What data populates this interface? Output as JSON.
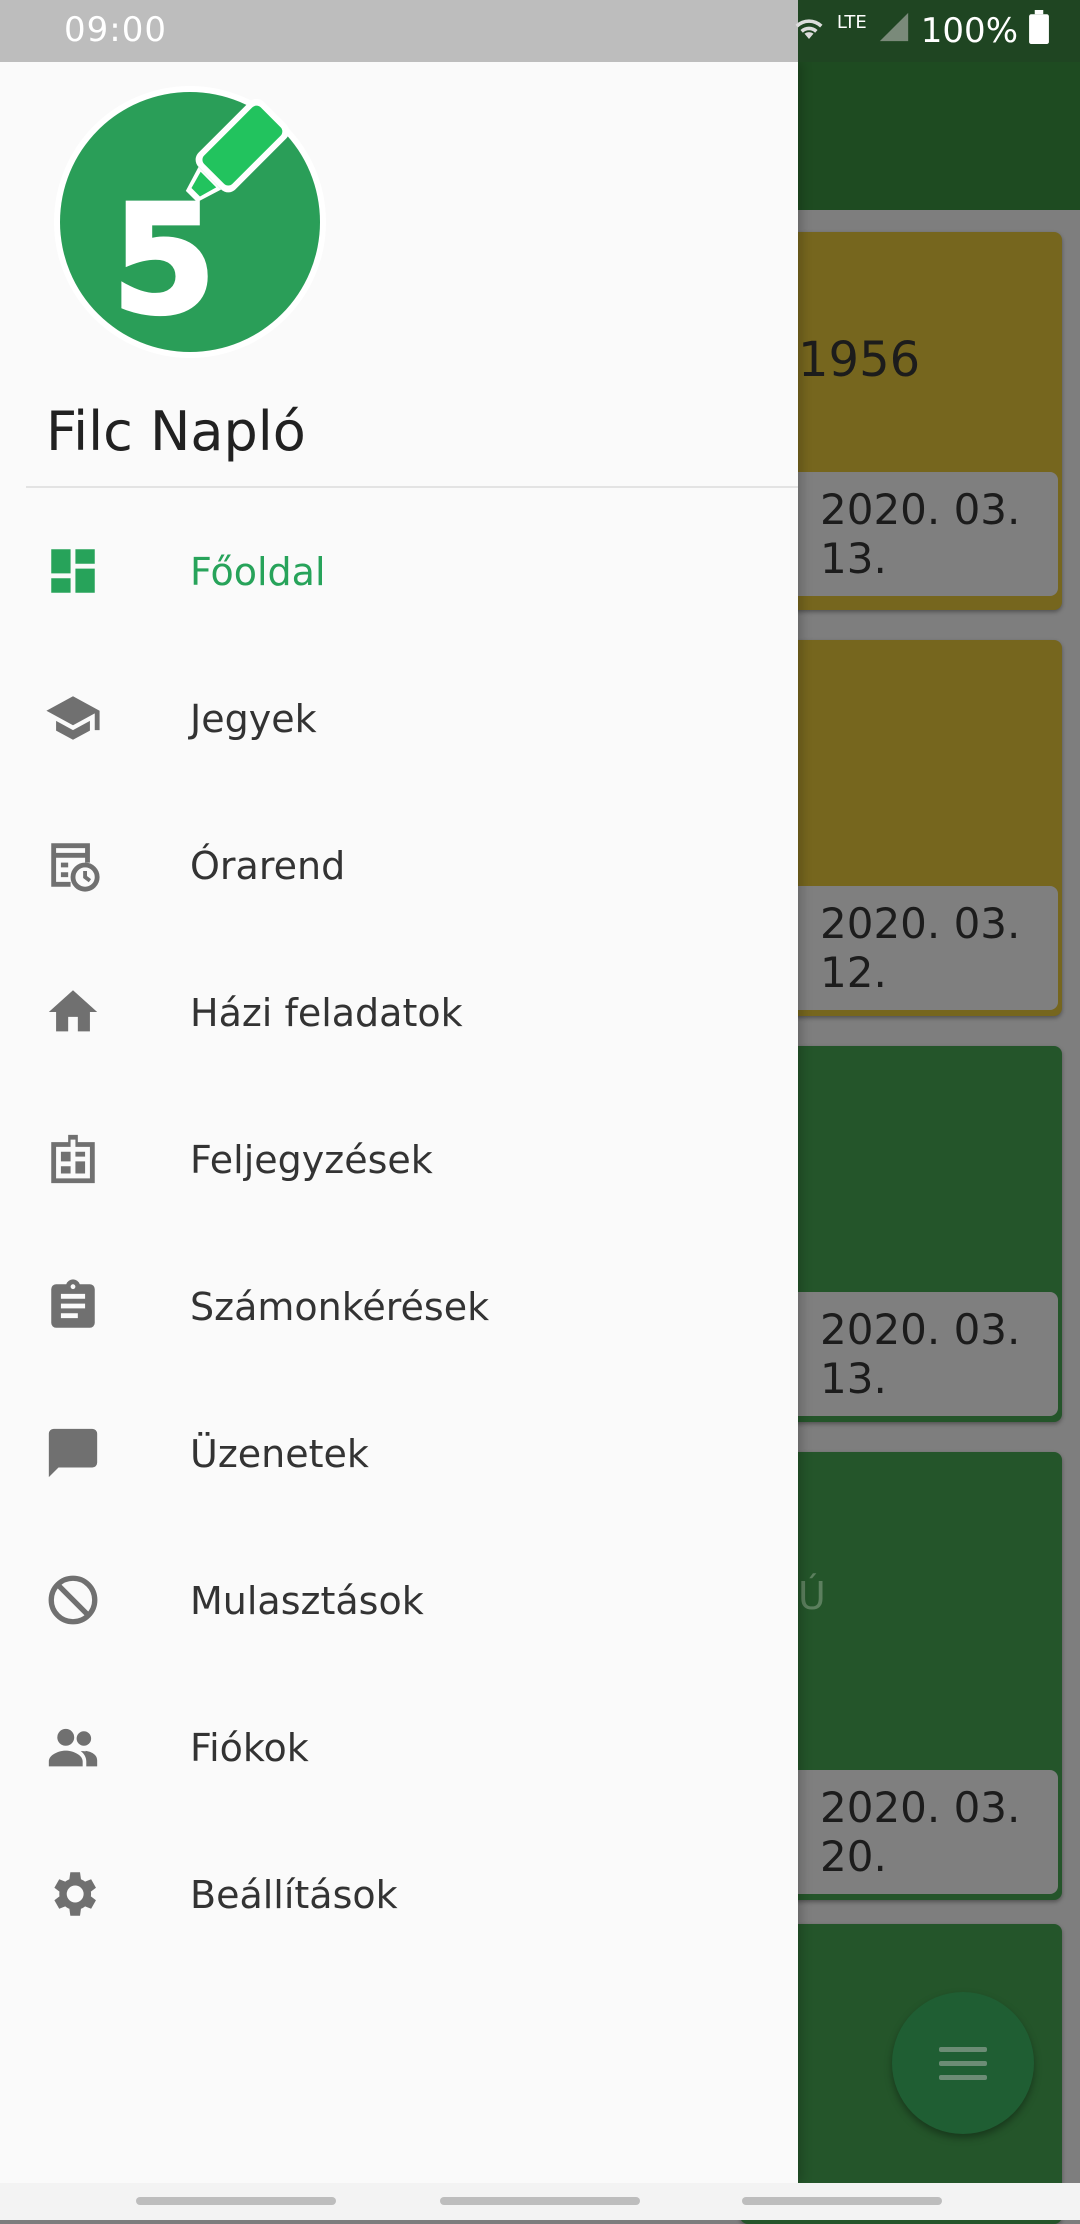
{
  "status_bar": {
    "time": "09:00",
    "network": "LTE",
    "battery": "100%"
  },
  "app": {
    "name": "Filc Napló",
    "logo_digit": "5",
    "accent_color": "#27a35a"
  },
  "drawer": {
    "items": [
      {
        "label": "Főoldal",
        "icon": "dashboard-icon",
        "active": true
      },
      {
        "label": "Jegyek",
        "icon": "school-cap-icon",
        "active": false
      },
      {
        "label": "Órarend",
        "icon": "timetable-icon",
        "active": false
      },
      {
        "label": "Házi feladatok",
        "icon": "home-icon",
        "active": false
      },
      {
        "label": "Feljegyzések",
        "icon": "notes-board-icon",
        "active": false
      },
      {
        "label": "Számonkérések",
        "icon": "clipboard-icon",
        "active": false
      },
      {
        "label": "Üzenetek",
        "icon": "message-icon",
        "active": false
      },
      {
        "label": "Mulasztások",
        "icon": "block-icon",
        "active": false
      },
      {
        "label": "Fiókok",
        "icon": "people-icon",
        "active": false
      },
      {
        "label": "Beállítások",
        "icon": "gear-icon",
        "active": false
      }
    ]
  },
  "background_cards": [
    {
      "title": "1956",
      "date": "2020. 03. 13.",
      "color": "#7a6a1f"
    },
    {
      "title": "",
      "date": "2020. 03. 12.",
      "color": "#7a6a1f"
    },
    {
      "title": "",
      "date": "2020. 03. 13.",
      "color": "#26602a"
    },
    {
      "title": "Ú",
      "date": "2020. 03. 20.",
      "color": "#26602a"
    },
    {
      "title": "",
      "date": "",
      "color": "#26602a"
    }
  ]
}
